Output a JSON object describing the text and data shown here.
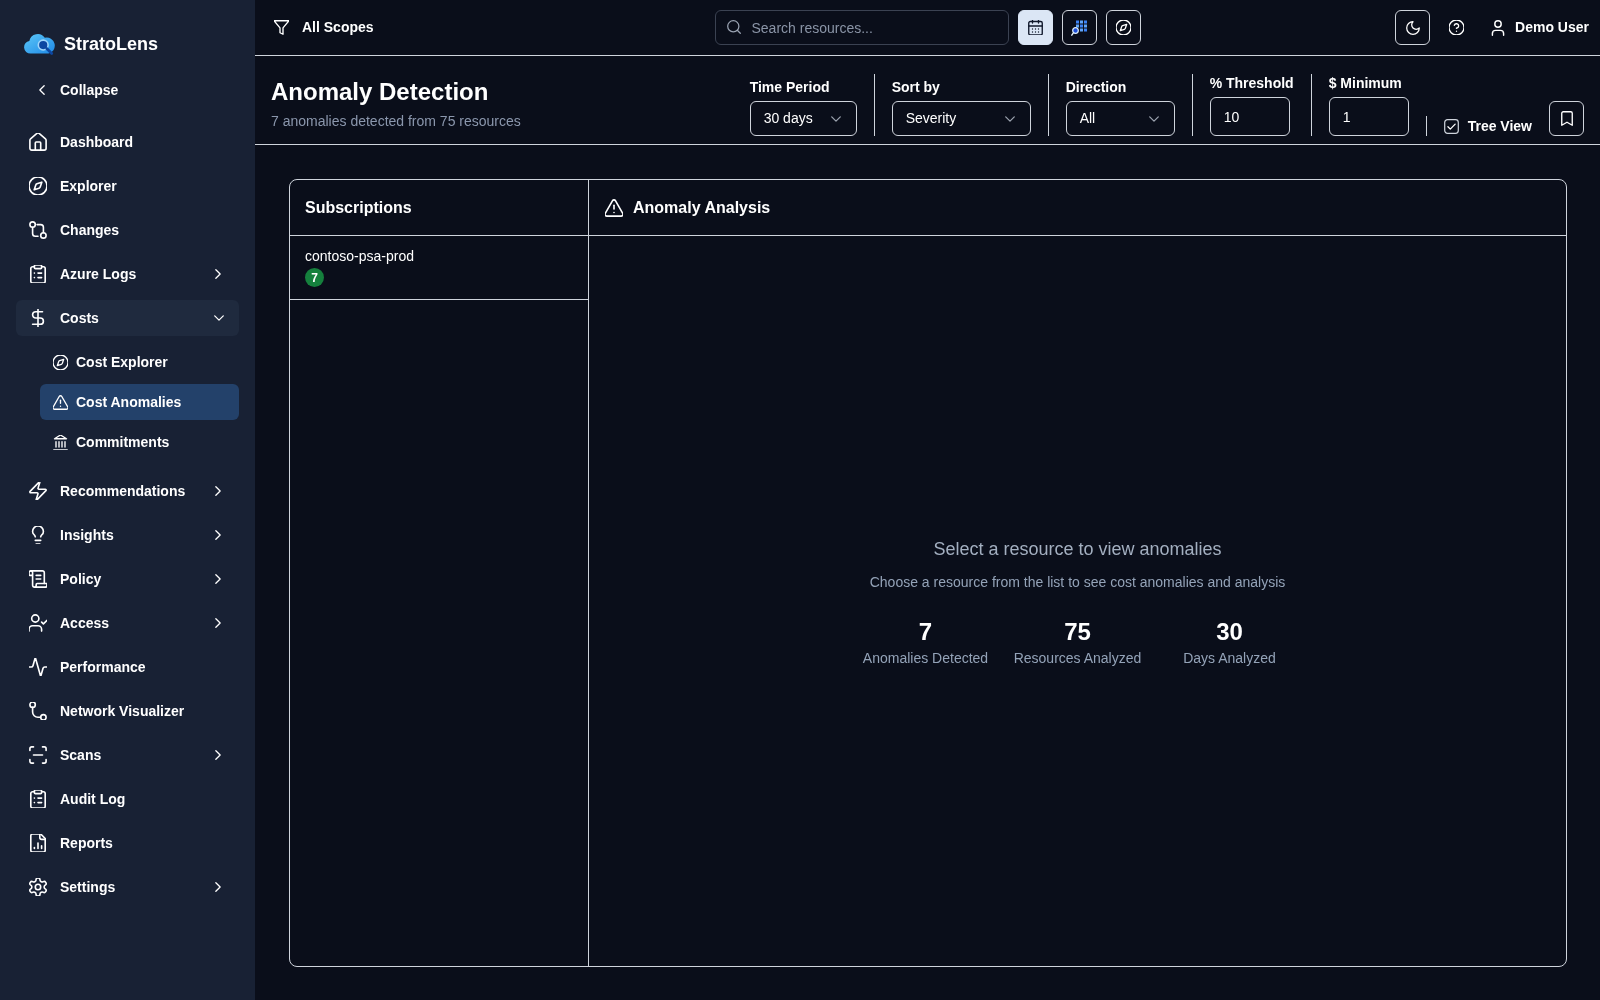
{
  "sidebar": {
    "brand": "StratoLens",
    "collapse": "Collapse",
    "items": [
      {
        "label": "Dashboard",
        "submenu": false,
        "expanded": false,
        "selected": false
      },
      {
        "label": "Explorer",
        "submenu": false,
        "expanded": false,
        "selected": false
      },
      {
        "label": "Changes",
        "submenu": false,
        "expanded": false,
        "selected": false
      },
      {
        "label": "Azure Logs",
        "submenu": true,
        "expanded": false,
        "selected": false
      },
      {
        "label": "Costs",
        "submenu": true,
        "expanded": true,
        "selected": false,
        "children": [
          {
            "label": "Cost Explorer",
            "selected": false
          },
          {
            "label": "Cost Anomalies",
            "selected": true
          },
          {
            "label": "Commitments",
            "selected": false
          }
        ]
      },
      {
        "label": "Recommendations",
        "submenu": true,
        "expanded": false,
        "selected": false
      },
      {
        "label": "Insights",
        "submenu": true,
        "expanded": false,
        "selected": false
      },
      {
        "label": "Policy",
        "submenu": true,
        "expanded": false,
        "selected": false
      },
      {
        "label": "Access",
        "submenu": true,
        "expanded": false,
        "selected": false
      },
      {
        "label": "Performance",
        "submenu": false,
        "expanded": false,
        "selected": false
      },
      {
        "label": "Network Visualizer",
        "submenu": false,
        "expanded": false,
        "selected": false
      },
      {
        "label": "Scans",
        "submenu": true,
        "expanded": false,
        "selected": false
      },
      {
        "label": "Audit Log",
        "submenu": false,
        "expanded": false,
        "selected": false
      },
      {
        "label": "Reports",
        "submenu": false,
        "expanded": false,
        "selected": false
      },
      {
        "label": "Settings",
        "submenu": true,
        "expanded": false,
        "selected": false
      }
    ]
  },
  "topbar": {
    "scope": "All Scopes",
    "search": {
      "placeholder": "Search resources..."
    },
    "view_buttons": [
      {
        "selected": true
      },
      {
        "selected": false
      },
      {
        "selected": false
      }
    ],
    "user": "Demo User"
  },
  "header": {
    "title": "Anomaly Detection",
    "subtitle": "7 anomalies detected from 75 resources",
    "filters": [
      {
        "kind": "select",
        "label": "Time Period",
        "value": "30 days"
      },
      {
        "kind": "select",
        "label": "Sort by",
        "value": "Severity"
      },
      {
        "kind": "select",
        "label": "Direction",
        "value": "All"
      },
      {
        "kind": "input",
        "label": "% Threshold",
        "value": "10"
      },
      {
        "kind": "input",
        "label": "$ Minimum",
        "value": "1"
      }
    ],
    "tree_view": {
      "label": "Tree View",
      "checked": true
    }
  },
  "subscriptions": {
    "title": "Subscriptions",
    "items": [
      {
        "name": "contoso-psa-prod",
        "count": "7",
        "selected": false
      }
    ]
  },
  "analysis": {
    "title": "Anomaly Analysis",
    "empty_title": "Select a resource to view anomalies",
    "empty_text": "Choose a resource from the list to see cost anomalies and analysis",
    "stats": [
      {
        "value": "7",
        "label": "Anomalies Detected"
      },
      {
        "value": "75",
        "label": "Resources Analyzed"
      },
      {
        "value": "30",
        "label": "Days Analyzed"
      }
    ]
  }
}
